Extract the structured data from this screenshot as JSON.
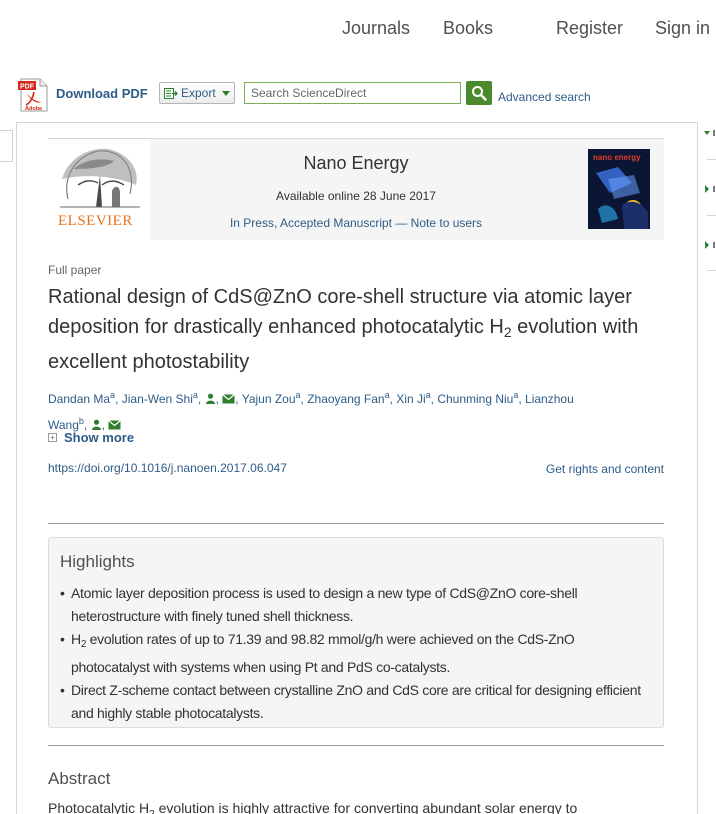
{
  "nav": {
    "journals": "Journals",
    "books": "Books",
    "register": "Register",
    "sign_in": "Sign in"
  },
  "toolbar": {
    "download_pdf": "Download PDF",
    "export": "Export",
    "search_placeholder": "Search ScienceDirect",
    "advanced_search": "Advanced search",
    "pdf_icon_label_top": "PDF",
    "pdf_icon_label_bottom": "Adobe"
  },
  "publication": {
    "publisher": "ELSEVIER",
    "journal": "Nano Energy",
    "available": "Available online 28 June 2017",
    "in_press": "In Press, Accepted Manuscript — Note to users",
    "cover_text": "nano energy"
  },
  "article": {
    "type": "Full paper",
    "title_part1": "Rational design of CdS@ZnO core-shell structure via atomic layer deposition for drastically enhanced photocatalytic H",
    "title_sub": "2",
    "title_part2": " evolution with excellent photostability",
    "authors": [
      {
        "name": "Dandan Ma",
        "aff": "a"
      },
      {
        "name": "Jian-Wen Shi",
        "aff": "a"
      },
      {
        "name": "Yajun Zou",
        "aff": "a"
      },
      {
        "name": "Zhaoyang Fan",
        "aff": "a"
      },
      {
        "name": "Xin Ji",
        "aff": "a"
      },
      {
        "name": "Chunming Niu",
        "aff": "a"
      },
      {
        "name": "Lianzhou Wang",
        "aff": "b"
      }
    ],
    "lianzhou_line1": "Lianzhou",
    "lianzhou_line2": "Wang",
    "show_more": "Show more",
    "doi": "https://doi.org/10.1016/j.nanoen.2017.06.047",
    "rights": "Get rights and content"
  },
  "highlights": {
    "title": "Highlights",
    "item1": "Atomic layer deposition process is used to design a new type of CdS@ZnO core-shell heterostructure with finely tuned shell thickness.",
    "item2_pre": "H",
    "item2_sub": "2",
    "item2_post": " evolution rates of up to 71.39 and 98.82 mmol/g/h were achieved on the CdS-ZnO photocatalyst with systems when using Pt and PdS co-catalysts.",
    "item3": "Direct Z-scheme contact between crystalline ZnO and CdS core are critical for designing efficient and highly stable photocatalysts."
  },
  "abstract": {
    "title": "Abstract",
    "text_start": "Photocatalytic H",
    "text_sub": "2",
    "text_rest": " evolution is highly attractive for converting abundant solar energy to"
  },
  "colors": {
    "link": "#2e5c88",
    "elsevier_orange": "#e9711c",
    "search_green": "#4a8a2b"
  }
}
